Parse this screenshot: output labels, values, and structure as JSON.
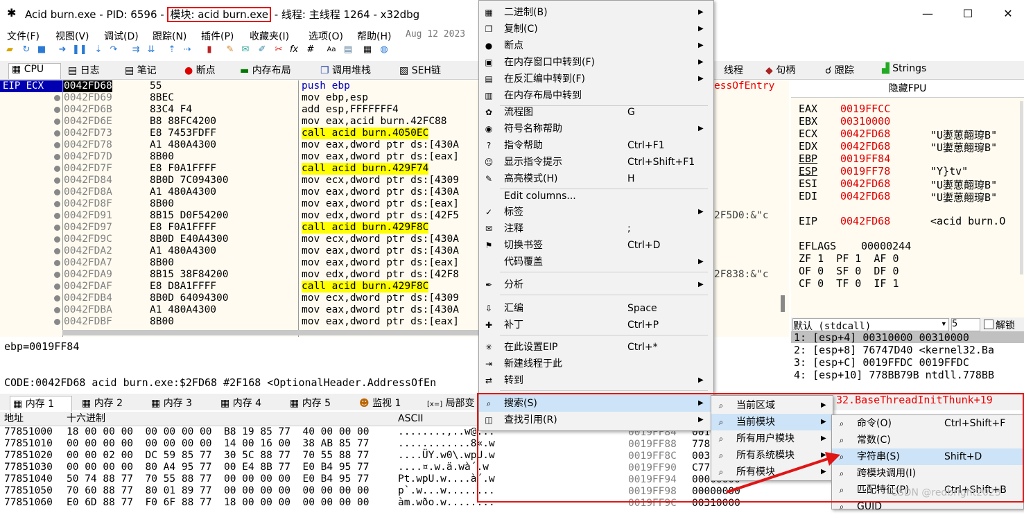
{
  "window": {
    "title_pre": "Acid burn.exe - PID: 6596 - ",
    "title_module": "模块: acid burn.exe",
    "title_post": " - 线程: 主线程 1264 - x32dbg"
  },
  "menubar": [
    "文件(F)",
    "视图(V)",
    "调试(D)",
    "跟踪(N)",
    "插件(P)",
    "收藏夹(I)",
    "选项(O)",
    "帮助(H)",
    "Aug 12 2023"
  ],
  "tabs": [
    "CPU",
    "日志",
    "笔记",
    "断点",
    "内存布局",
    "调用堆栈",
    "SEH链",
    "线程",
    "句柄",
    "跟踪",
    "Strings"
  ],
  "disasm": {
    "header": "EIP ECX",
    "rows": [
      {
        "addr": "0042FD68",
        "bytes": "55",
        "instr": "push ebp",
        "style": "push"
      },
      {
        "addr": "0042FD69",
        "bytes": "8BEC",
        "instr": "mov ebp,esp",
        "style": ""
      },
      {
        "addr": "0042FD6B",
        "bytes": "83C4 F4",
        "instr": "add esp,FFFFFFF4",
        "style": ""
      },
      {
        "addr": "0042FD6E",
        "bytes": "B8 88FC4200",
        "instr": "mov eax,acid burn.42FC88",
        "style": ""
      },
      {
        "addr": "0042FD73",
        "bytes": "E8 7453FDFF",
        "instr": "call acid burn.4050EC",
        "style": "call"
      },
      {
        "addr": "0042FD78",
        "bytes": "A1 480A4300",
        "instr": "mov eax,dword ptr ds:[430A",
        "style": ""
      },
      {
        "addr": "0042FD7D",
        "bytes": "8B00",
        "instr": "mov eax,dword ptr ds:[eax]",
        "style": ""
      },
      {
        "addr": "0042FD7F",
        "bytes": "E8 F0A1FFFF",
        "instr": "call acid burn.429F74",
        "style": "call"
      },
      {
        "addr": "0042FD84",
        "bytes": "8B0D 7C094300",
        "instr": "mov ecx,dword ptr ds:[4309",
        "style": ""
      },
      {
        "addr": "0042FD8A",
        "bytes": "A1 480A4300",
        "instr": "mov eax,dword ptr ds:[430A",
        "style": ""
      },
      {
        "addr": "0042FD8F",
        "bytes": "8B00",
        "instr": "mov eax,dword ptr ds:[eax]",
        "style": ""
      },
      {
        "addr": "0042FD91",
        "bytes": "8B15 D0F54200",
        "instr": "mov edx,dword ptr ds:[42F5",
        "style": ""
      },
      {
        "addr": "0042FD97",
        "bytes": "E8 F0A1FFFF",
        "instr": "call acid burn.429F8C",
        "style": "call"
      },
      {
        "addr": "0042FD9C",
        "bytes": "8B0D E40A4300",
        "instr": "mov ecx,dword ptr ds:[430A",
        "style": ""
      },
      {
        "addr": "0042FDA2",
        "bytes": "A1 480A4300",
        "instr": "mov eax,dword ptr ds:[430A",
        "style": ""
      },
      {
        "addr": "0042FDA7",
        "bytes": "8B00",
        "instr": "mov eax,dword ptr ds:[eax]",
        "style": ""
      },
      {
        "addr": "0042FDA9",
        "bytes": "8B15 38F84200",
        "instr": "mov edx,dword ptr ds:[42F8",
        "style": ""
      },
      {
        "addr": "0042FDAF",
        "bytes": "E8 D8A1FFFF",
        "instr": "call acid burn.429F8C",
        "style": "call"
      },
      {
        "addr": "0042FDB4",
        "bytes": "8B0D 64094300",
        "instr": "mov ecx,dword ptr ds:[4309",
        "style": ""
      },
      {
        "addr": "0042FDBA",
        "bytes": "A1 480A4300",
        "instr": "mov eax,dword ptr ds:[430A",
        "style": ""
      },
      {
        "addr": "0042FDBF",
        "bytes": "8B00",
        "instr": "mov eax,dword ptr ds:[eax]",
        "style": ""
      }
    ],
    "right_frag_1": "essOfEntry",
    "right_frag_2": "2F5D0:&\"c",
    "right_frag_3": "2F838:&\"c"
  },
  "info": {
    "line1": "ebp=0019FF84",
    "line2": "CODE:0042FD68 acid burn.exe:$2FD68 #2F168 <OptionalHeader.AddressOfEn"
  },
  "regs": {
    "header": "隐藏FPU",
    "list": [
      {
        "n": "EAX",
        "v": "0019FFCC",
        "c": ""
      },
      {
        "n": "EBX",
        "v": "00310000",
        "c": ""
      },
      {
        "n": "ECX",
        "v": "0042FD68",
        "c": "\"U嬱葸翸瑏B\""
      },
      {
        "n": "EDX",
        "v": "0042FD68",
        "c": "\"U嬱葸翸瑏B\""
      },
      {
        "n": "EBP",
        "v": "0019FF84",
        "c": ""
      },
      {
        "n": "ESP",
        "v": "0019FF78",
        "c": "\"Y}tv\""
      },
      {
        "n": "ESI",
        "v": "0042FD68",
        "c": "\"U嬱葸翸瑏B\""
      },
      {
        "n": "EDI",
        "v": "0042FD68",
        "c": "\"U嬱葸翸瑏B\""
      }
    ],
    "eip_name": "EIP",
    "eip_val": "0042FD68",
    "eip_cmt": "<acid burn.O",
    "eflags_name": "EFLAGS",
    "eflags_val": "00000244",
    "flags": [
      "ZF 1  PF 1  AF 0",
      "OF 0  SF 0  DF 0",
      "CF 0  TF 0  IF 1"
    ],
    "callconv": "默认 (stdcall)",
    "argcount": "5",
    "unlock": "解锁"
  },
  "stack": [
    "1: [esp+4] 00310000 00310000",
    "2: [esp+8] 76747D40 <kernel32.Ba",
    "3: [esp+C] 0019FFDC 0019FFDC",
    "4: [esp+10] 778BB79B ntdll.778BB"
  ],
  "bottom_tabs": [
    "内存 1",
    "内存 2",
    "内存 3",
    "内存 4",
    "内存 5",
    "监视 1",
    "局部变"
  ],
  "dump": {
    "headers": [
      "地址",
      "十六进制",
      "ASCII"
    ],
    "rows": [
      {
        "a": "77851000",
        "h": "18 00 00 00  00 00 00 00  B8 19 85 77  40 00 00 00",
        "s": "........,..w@..."
      },
      {
        "a": "77851010",
        "h": "00 00 00 00  00 00 00 00  14 00 16 00  38 AB 85 77",
        "s": "............8«.w"
      },
      {
        "a": "77851020",
        "h": "00 00 02 00  DC 59 85 77  30 5C 88 77  70 55 88 77",
        "s": "....ÜY.w0\\.wpU.w"
      },
      {
        "a": "77851030",
        "h": "00 00 00 00  80 A4 95 77  00 E4 8B 77  E0 B4 95 77",
        "s": "....¤.w.ä.wà´.w"
      },
      {
        "a": "77851040",
        "h": "50 74 88 77  70 55 88 77  00 00 00 00  E0 B4 95 77",
        "s": "Pt.wpU.w....à´.w"
      },
      {
        "a": "77851050",
        "h": "70 60 88 77  80 01 89 77  00 00 00 00  00 00 00 00",
        "s": "p`.w...w........"
      },
      {
        "a": "77851060",
        "h": "E0 6D 88 77  F0 6F 88 77  18 00 00 00  00 00 00 00",
        "s": "àm.wðo.w........"
      }
    ]
  },
  "stack2": {
    "rows": [
      {
        "a": "0019FF84",
        "v": "0019FF88"
      },
      {
        "a": "0019FF88",
        "v": "778"
      },
      {
        "a": "0019FF8C",
        "v": "003"
      },
      {
        "a": "0019FF90",
        "v": "C77"
      },
      {
        "a": "0019FF94",
        "v": "00000000"
      },
      {
        "a": "0019FF98",
        "v": "00000000"
      },
      {
        "a": "0019FF9C",
        "v": "00310000"
      }
    ],
    "red_frag": "32.BaseThreadInitThunk+19"
  },
  "context_menu": {
    "items": [
      {
        "icon": "▦",
        "label": "二进制(B)",
        "sc": "",
        "arr": true
      },
      {
        "icon": "❐",
        "label": "复制(C)",
        "sc": "",
        "arr": true
      },
      {
        "icon": "●",
        "label": "断点",
        "sc": "",
        "arr": true
      },
      {
        "icon": "▣",
        "label": "在内存窗口中转到(F)",
        "sc": "",
        "arr": true
      },
      {
        "icon": "▤",
        "label": "在反汇编中转到(F)",
        "sc": "",
        "arr": true
      },
      {
        "icon": "▥",
        "label": "在内存布局中转到",
        "sc": "",
        "arr": false
      },
      {
        "icon": "✿",
        "label": "流程图",
        "sc": "G",
        "arr": false
      },
      {
        "icon": "◉",
        "label": "符号名称帮助",
        "sc": "",
        "arr": true
      },
      {
        "icon": "?",
        "label": "指令帮助",
        "sc": "Ctrl+F1",
        "arr": false
      },
      {
        "icon": "☺",
        "label": "显示指令提示",
        "sc": "Ctrl+Shift+F1",
        "arr": false
      },
      {
        "icon": "✎",
        "label": "高亮模式(H)",
        "sc": "H",
        "arr": false
      },
      {
        "icon": "",
        "label": "Edit columns...",
        "sc": "",
        "arr": false
      },
      {
        "icon": "✓",
        "label": "标签",
        "sc": "",
        "arr": true
      },
      {
        "icon": "✉",
        "label": "注释",
        "sc": ";",
        "arr": false
      },
      {
        "icon": "⚑",
        "label": "切换书签",
        "sc": "Ctrl+D",
        "arr": false
      },
      {
        "icon": "",
        "label": "代码覆盖",
        "sc": "",
        "arr": true
      },
      {
        "icon": "✒",
        "label": "分析",
        "sc": "",
        "arr": true
      },
      {
        "icon": "⇩",
        "label": "汇编",
        "sc": "Space",
        "arr": false
      },
      {
        "icon": "✚",
        "label": "补丁",
        "sc": "Ctrl+P",
        "arr": false
      },
      {
        "icon": "✳",
        "label": "在此设置EIP",
        "sc": "Ctrl+*",
        "arr": false
      },
      {
        "icon": "⇥",
        "label": "新建线程于此",
        "sc": "",
        "arr": false
      },
      {
        "icon": "⇄",
        "label": "转到",
        "sc": "",
        "arr": true
      },
      {
        "icon": "⌕",
        "label": "搜索(S)",
        "sc": "",
        "arr": true
      },
      {
        "icon": "◫",
        "label": "查找引用(R)",
        "sc": "",
        "arr": true
      }
    ],
    "sub1": [
      "当前区域",
      "当前模块",
      "所有用户模块",
      "所有系统模块",
      "所有模块"
    ],
    "sub2": [
      {
        "label": "命令(O)",
        "sc": "Ctrl+Shift+F"
      },
      {
        "label": "常数(C)",
        "sc": ""
      },
      {
        "label": "字符串(S)",
        "sc": "Shift+D"
      },
      {
        "label": "跨模块调用(I)",
        "sc": ""
      },
      {
        "label": "匹配特征(P)",
        "sc": "Ctrl+Shift+B"
      },
      {
        "label": "GUID",
        "sc": ""
      }
    ]
  },
  "watermark": "CSDN @redbright2023"
}
